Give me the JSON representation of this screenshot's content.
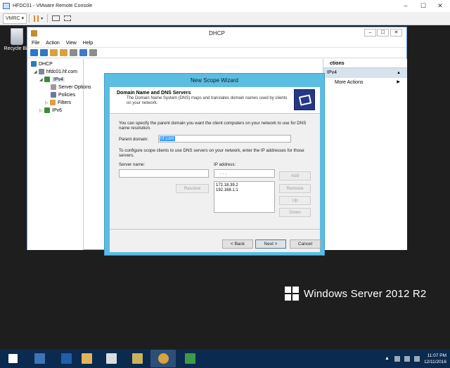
{
  "vmware": {
    "title": "HFDC01 - VMware Remote Console",
    "vmrc_label": "VMRC",
    "caret": "▾",
    "pause_icon": "pause-icon",
    "fullscreen_icon": "fullscreen-icon"
  },
  "desktop": {
    "recycle_bin_label": "Recycle Bin",
    "brand_text": "Windows Server 2012 R2"
  },
  "dhcp": {
    "title": "DHCP",
    "menu": [
      "File",
      "Action",
      "View",
      "Help"
    ],
    "tree": {
      "root": "DHCP",
      "server": "hfdc01.hf.com",
      "ipv4": "IPv4",
      "server_options": "Server Options",
      "policies": "Policies",
      "filters": "Filters",
      "ipv6": "IPv6"
    },
    "actions": {
      "header": "ctions",
      "selected": "IPv4",
      "more": "More Actions"
    }
  },
  "wizard": {
    "title": "New Scope Wizard",
    "header_title": "Domain Name and DNS Servers",
    "header_desc": "The Domain Name System (DNS) maps and translates domain names used by clients on your network.",
    "intro": "You can specify the parent domain you want the client computers on your network to use for DNS name resolution.",
    "parent_domain_label": "Parent domain:",
    "parent_domain_value": "hf.com",
    "config_text": "To configure scope clients to use DNS servers on your network, enter the IP addresses for those servers.",
    "server_name_label": "Server name:",
    "server_name_value": "",
    "ip_address_label": "IP address:",
    "ip_address_value": ". . .",
    "ip_list": [
      "172.18.39.2",
      "192.168.1.1"
    ],
    "buttons": {
      "resolve": "Resolve",
      "add": "Add",
      "remove": "Remove",
      "up": "Up",
      "down": "Down",
      "back": "< Back",
      "next": "Next >",
      "cancel": "Cancel"
    }
  },
  "taskbar": {
    "time": "11:07 PM",
    "date": "12/11/2016"
  },
  "colors": {
    "wizard_border": "#5bbde2",
    "selection": "#3399ff",
    "taskbar": "#0b2a4f"
  }
}
